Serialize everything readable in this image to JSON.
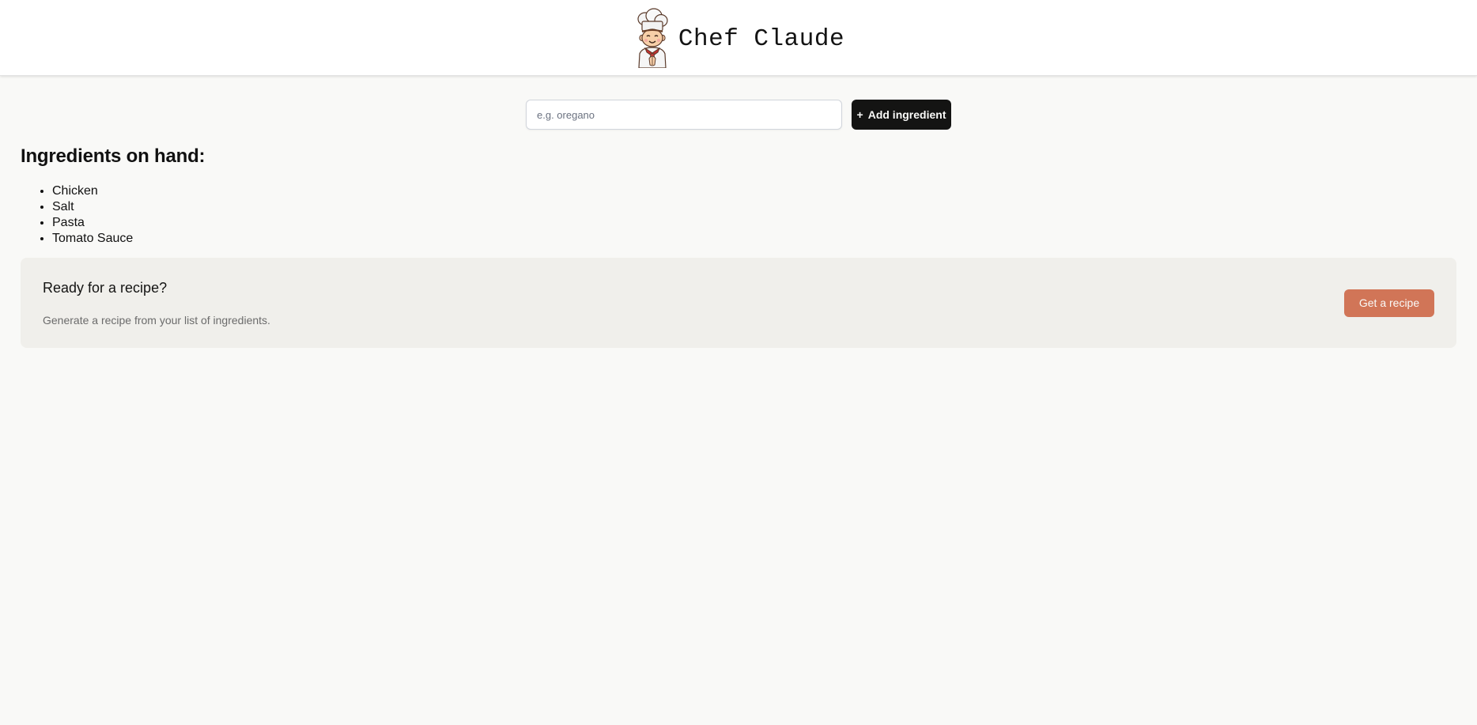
{
  "app": {
    "title": "Chef Claude",
    "logo_icon": "chef-mascot-icon"
  },
  "form": {
    "placeholder": "e.g. oregano",
    "add_button_icon": "+",
    "add_button_label": "Add ingredient"
  },
  "ingredients": {
    "heading": "Ingredients on hand:",
    "items": [
      "Chicken",
      "Salt",
      "Pasta",
      "Tomato Sauce"
    ]
  },
  "recipe_panel": {
    "heading": "Ready for a recipe?",
    "description": "Generate a recipe from your list of ingredients.",
    "button_label": "Get a recipe"
  },
  "colors": {
    "page_background": "#f9f9f7",
    "header_background": "#ffffff",
    "add_button": "#141413",
    "get_recipe_button": "#d17557",
    "panel_background": "#f0efeb"
  }
}
